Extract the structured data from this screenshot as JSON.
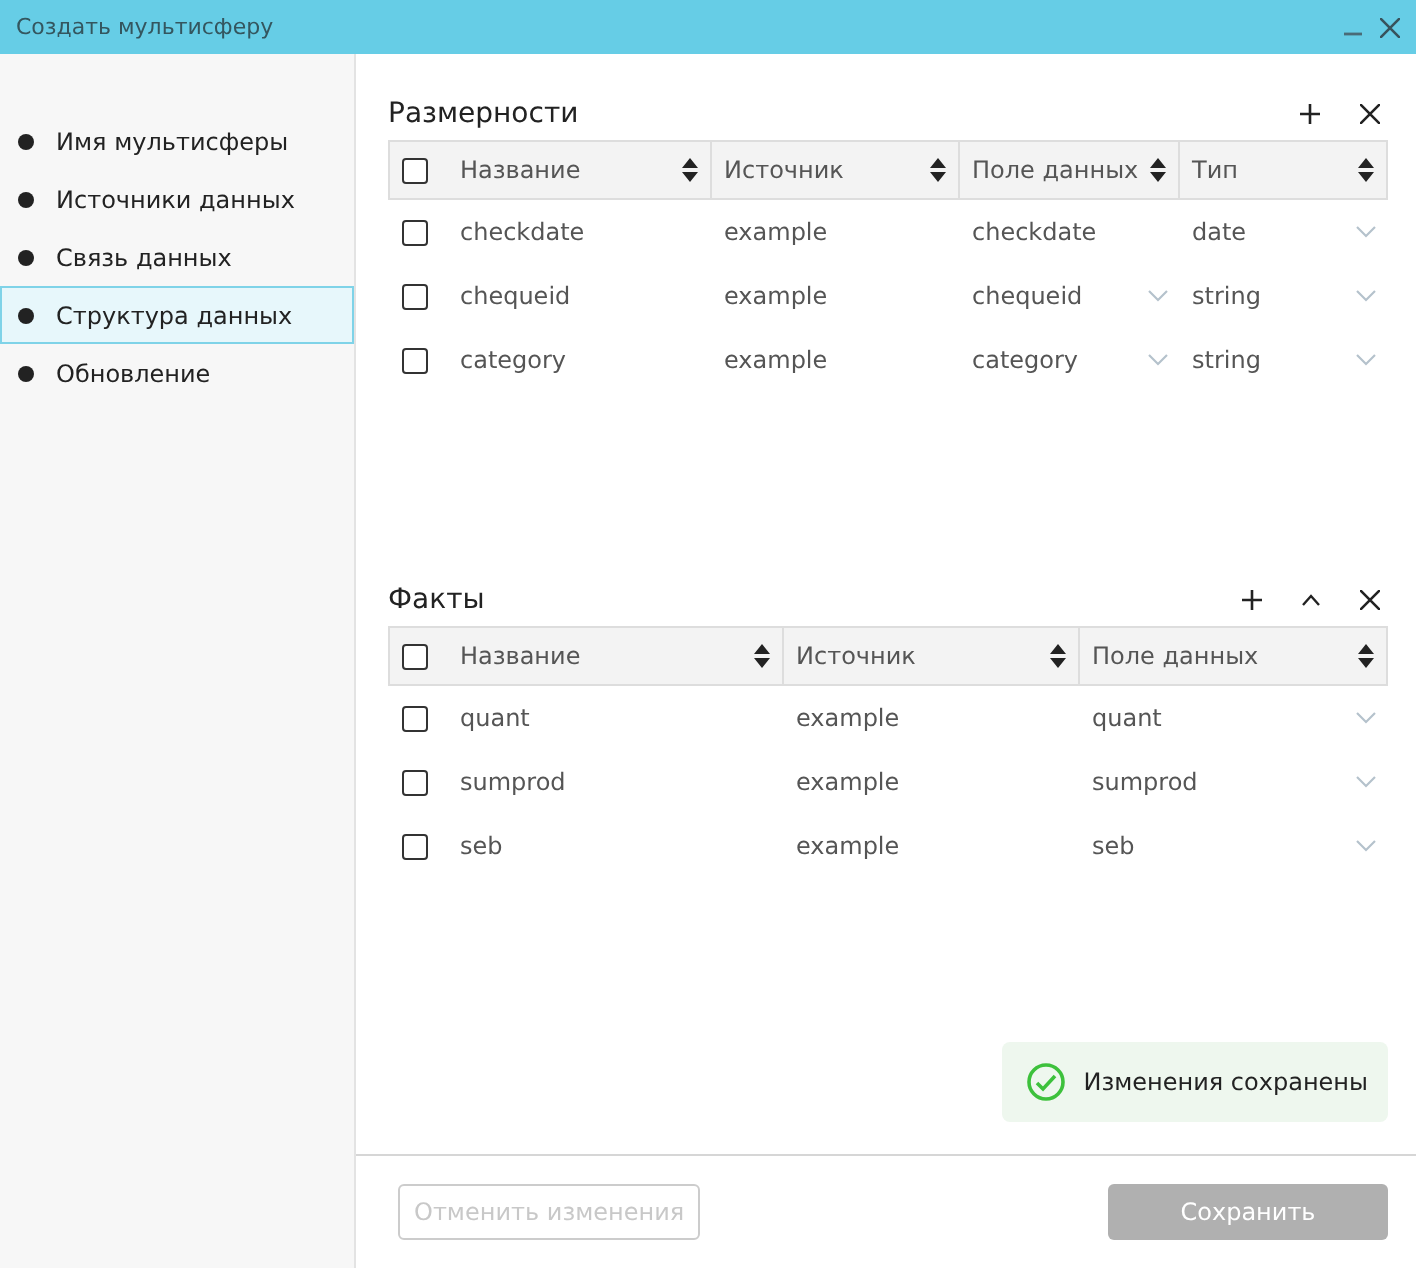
{
  "window": {
    "title": "Создать мультисферу",
    "controls": [
      {
        "kind": "minimize"
      },
      {
        "kind": "close"
      }
    ]
  },
  "sidebar": {
    "items": [
      {
        "label": "Имя мультисферы",
        "selected": false
      },
      {
        "label": "Источники данных",
        "selected": false
      },
      {
        "label": "Связь данных",
        "selected": false
      },
      {
        "label": "Структура данных",
        "selected": true
      },
      {
        "label": "Обновление",
        "selected": false
      }
    ]
  },
  "sections": [
    {
      "title": "Размерности",
      "tools": [
        {
          "kind": "add"
        },
        {
          "kind": "close"
        }
      ],
      "columns": [
        {
          "label": "Название",
          "sortable": true
        },
        {
          "label": "Источник",
          "sortable": true
        },
        {
          "label": "Поле данных",
          "sortable": true
        },
        {
          "label": "Тип",
          "sortable": true
        }
      ],
      "all_checked": false,
      "rows": [
        {
          "checked": false,
          "cells": [
            {
              "text": "checkdate",
              "dropdown": false
            },
            {
              "text": "example",
              "dropdown": false
            },
            {
              "text": "checkdate",
              "dropdown": false
            },
            {
              "text": "date",
              "dropdown": true
            }
          ]
        },
        {
          "checked": false,
          "cells": [
            {
              "text": "chequeid",
              "dropdown": false
            },
            {
              "text": "example",
              "dropdown": false
            },
            {
              "text": "chequeid",
              "dropdown": true
            },
            {
              "text": "string",
              "dropdown": true
            }
          ]
        },
        {
          "checked": false,
          "cells": [
            {
              "text": "category",
              "dropdown": false
            },
            {
              "text": "example",
              "dropdown": false
            },
            {
              "text": "category",
              "dropdown": true
            },
            {
              "text": "string",
              "dropdown": true
            }
          ]
        }
      ]
    },
    {
      "title": "Факты",
      "tools": [
        {
          "kind": "add"
        },
        {
          "kind": "collapse"
        },
        {
          "kind": "close"
        }
      ],
      "columns": [
        {
          "label": "Название",
          "sortable": true
        },
        {
          "label": "Источник",
          "sortable": true
        },
        {
          "label": "Поле данных",
          "sortable": true
        }
      ],
      "all_checked": false,
      "rows": [
        {
          "checked": false,
          "cells": [
            {
              "text": "quant",
              "dropdown": false
            },
            {
              "text": "example",
              "dropdown": false
            },
            {
              "text": "quant",
              "dropdown": true
            }
          ]
        },
        {
          "checked": false,
          "cells": [
            {
              "text": "sumprod",
              "dropdown": false
            },
            {
              "text": "example",
              "dropdown": false
            },
            {
              "text": "sumprod",
              "dropdown": true
            }
          ]
        },
        {
          "checked": false,
          "cells": [
            {
              "text": "seb",
              "dropdown": false
            },
            {
              "text": "example",
              "dropdown": false
            },
            {
              "text": "seb",
              "dropdown": true
            }
          ]
        }
      ]
    }
  ],
  "notification": {
    "text": "Изменения сохранены",
    "kind": "success"
  },
  "buttons": [
    {
      "label": "Отменить изменения",
      "kind": "secondary",
      "disabled": true
    },
    {
      "label": "Сохранить",
      "kind": "primary",
      "disabled": true
    }
  ]
}
